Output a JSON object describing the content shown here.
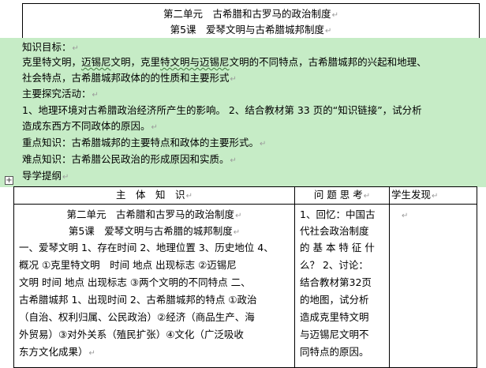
{
  "header": {
    "unit_title": "第二单元　古希腊和古罗马的政治制度",
    "lesson_title": "第5课　爱琴文明与古希腊城邦制度"
  },
  "objectives": {
    "label": "知识目标：",
    "line1_pre": "克里特文明，",
    "line1_w1": "迈锡尼",
    "line1_mid": "文明，克里",
    "line1_w2": "特文明与迈锡尼",
    "line1_post": "文明的不同特点，古希腊城邦的兴起和地理、",
    "line2": "社会特点，古希腊城邦政体的的性质和主要形式"
  },
  "inquiry": {
    "label": "主要探究活动：",
    "line1": "1、地理环境对古希腊政治经济所产生的影响。 2、结合教材第 33 页的“知识链接”，试分析",
    "line2": "造成东西方不同政体的原因。"
  },
  "key_points": "重点知识：古希腊城邦的主要特点和政体的主要形式。",
  "difficult_points": "难点知识：古希腊公民政治的形成原因和实质。",
  "guide_label": "导学提纲",
  "table": {
    "headers": [
      "主　体　知　识",
      "问 题 思 考",
      "学生发现"
    ],
    "col1": {
      "title1": "第二单元　古希腊和古罗马的政治制度",
      "title2": "第5课　爱琴文明与古希腊的城邦制度",
      "lines": [
        "一、爱琴文明 1、存在时间 2、地理位置 3、历史地位 4、",
        "概况 ①克里特文明　时间 地点 出现标志 ②迈锡尼",
        "文明 时间 地点 出现标志 ③两个文明的不同特点 二、",
        "古希腊城邦 1、出现时间 2、古希腊城邦的特点 ①政治",
        "（自治、权利归属、公民政治）②经济（商品生产、海",
        "外贸易）③对外关系（殖民扩张）④文化（广泛吸收",
        "东方文化成果）"
      ]
    },
    "col2": {
      "lines": [
        "1、回忆：中国古",
        "代社会政治制度",
        "的 基 本 特 征 什",
        "么？ 2、讨论：",
        "结合教材第32页",
        "的地图，试分析",
        "造成克里特文明",
        "与迈锡尼文明不",
        "同特点的原因。"
      ]
    }
  }
}
